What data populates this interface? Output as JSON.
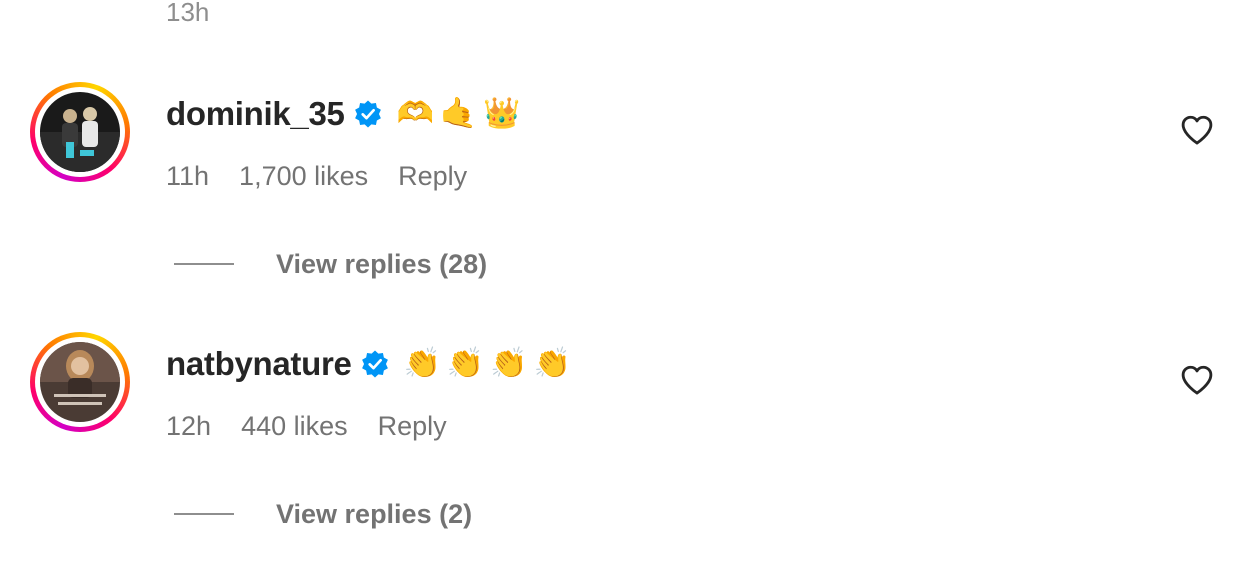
{
  "previous_comment": {
    "time": "13h"
  },
  "comments": [
    {
      "username": "dominik_35",
      "verified": true,
      "text": "🫶🤙👑",
      "time": "11h",
      "likes": "1,700 likes",
      "reply_label": "Reply",
      "view_replies": "View replies (28)"
    },
    {
      "username": "natbynature",
      "verified": true,
      "text": "👏👏👏👏",
      "time": "12h",
      "likes": "440 likes",
      "reply_label": "Reply",
      "view_replies": "View replies (2)"
    }
  ],
  "colors": {
    "text_primary": "#262626",
    "text_secondary": "#737373",
    "verified_blue": "#0095f6",
    "story_ring": [
      "#d300c5",
      "#ff0069",
      "#ff7a00",
      "#ffd600"
    ]
  },
  "icons": {
    "verified": "verified-badge-icon",
    "like": "heart-outline-icon"
  }
}
